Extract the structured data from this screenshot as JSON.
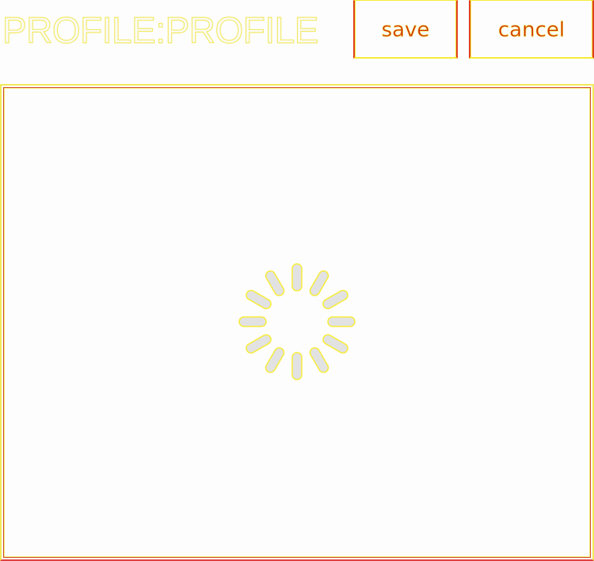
{
  "header": {
    "title": "PROFILE:PROFILE"
  },
  "toolbar": {
    "save_label": "save",
    "cancel_label": "cancel"
  },
  "content": {
    "loading_indicator": "spinner-icon"
  },
  "colors": {
    "title_outline": "#f3ea6a",
    "button_text": "#d03010",
    "button_edge": "#e04020",
    "highlight": "#f6ec3a",
    "spinner_fill": "#e2e2e2",
    "spinner_outline": "#f6ec3a",
    "background": "#fdfdfd"
  }
}
